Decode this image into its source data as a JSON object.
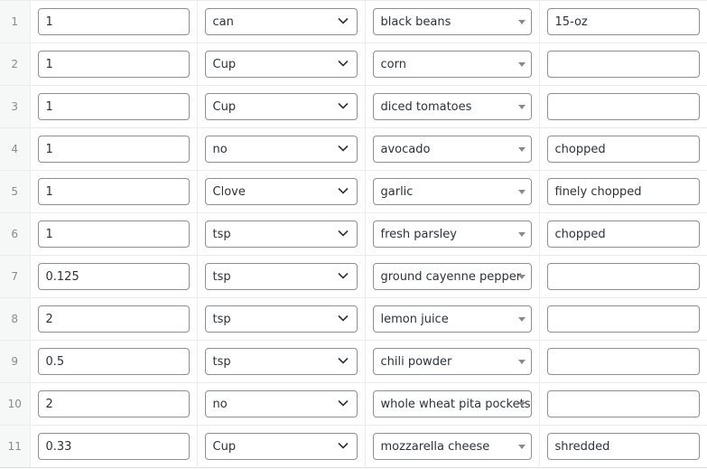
{
  "rows": [
    {
      "num": "1",
      "amount": "1",
      "unit": "can",
      "ingredient": "black beans",
      "notes": "15-oz"
    },
    {
      "num": "2",
      "amount": "1",
      "unit": "Cup",
      "ingredient": "corn",
      "notes": ""
    },
    {
      "num": "3",
      "amount": "1",
      "unit": "Cup",
      "ingredient": "diced tomatoes",
      "notes": ""
    },
    {
      "num": "4",
      "amount": "1",
      "unit": "no",
      "ingredient": "avocado",
      "notes": "chopped"
    },
    {
      "num": "5",
      "amount": "1",
      "unit": "Clove",
      "ingredient": "garlic",
      "notes": "finely chopped"
    },
    {
      "num": "6",
      "amount": "1",
      "unit": "tsp",
      "ingredient": "fresh parsley",
      "notes": "chopped"
    },
    {
      "num": "7",
      "amount": "0.125",
      "unit": "tsp",
      "ingredient": "ground cayenne pepper",
      "notes": ""
    },
    {
      "num": "8",
      "amount": "2",
      "unit": "tsp",
      "ingredient": "lemon juice",
      "notes": ""
    },
    {
      "num": "9",
      "amount": "0.5",
      "unit": "tsp",
      "ingredient": "chili powder",
      "notes": ""
    },
    {
      "num": "10",
      "amount": "2",
      "unit": "no",
      "ingredient": "whole wheat pita pockets",
      "notes": ""
    },
    {
      "num": "11",
      "amount": "0.33",
      "unit": "Cup",
      "ingredient": "mozzarella cheese",
      "notes": "shredded"
    }
  ]
}
